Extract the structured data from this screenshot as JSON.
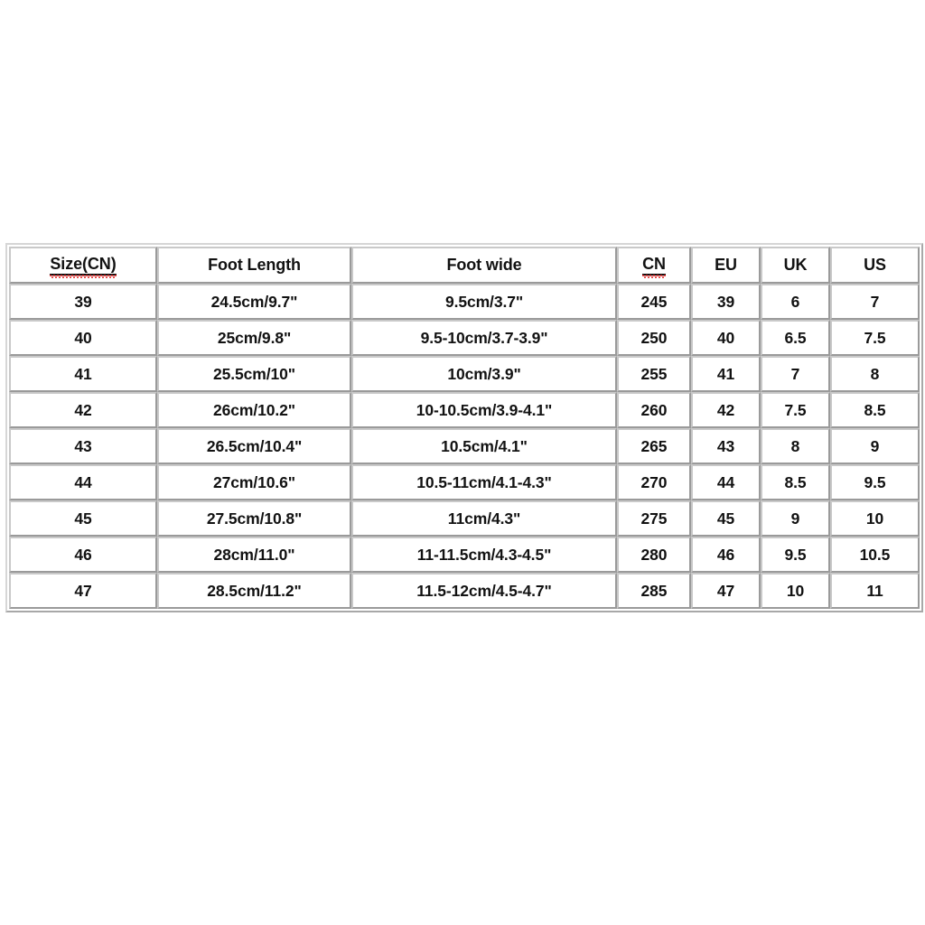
{
  "page": {
    "background_color": "#ffffff",
    "text_color": "#121212",
    "border_color": "#9a9a9a",
    "spellcheck_color": "#e01b1b"
  },
  "table": {
    "name": "shoe-size-conversion-chart",
    "headers": [
      {
        "label": "Size(CN)",
        "underlined": true,
        "spellcheck": true
      },
      {
        "label": "Foot Length",
        "underlined": false,
        "spellcheck": false
      },
      {
        "label": "Foot wide",
        "underlined": false,
        "spellcheck": false
      },
      {
        "label": "CN",
        "underlined": true,
        "spellcheck": true
      },
      {
        "label": "EU",
        "underlined": false,
        "spellcheck": false
      },
      {
        "label": "UK",
        "underlined": false,
        "spellcheck": false
      },
      {
        "label": "US",
        "underlined": false,
        "spellcheck": false
      }
    ],
    "rows": [
      {
        "size_cn": "39",
        "foot_length": "24.5cm/9.7\"",
        "foot_wide": "9.5cm/3.7\"",
        "cn": "245",
        "eu": "39",
        "uk": "6",
        "us": "7"
      },
      {
        "size_cn": "40",
        "foot_length": "25cm/9.8\"",
        "foot_wide": "9.5-10cm/3.7-3.9\"",
        "cn": "250",
        "eu": "40",
        "uk": "6.5",
        "us": "7.5"
      },
      {
        "size_cn": "41",
        "foot_length": "25.5cm/10\"",
        "foot_wide": "10cm/3.9\"",
        "cn": "255",
        "eu": "41",
        "uk": "7",
        "us": "8"
      },
      {
        "size_cn": "42",
        "foot_length": "26cm/10.2\"",
        "foot_wide": "10-10.5cm/3.9-4.1\"",
        "cn": "260",
        "eu": "42",
        "uk": "7.5",
        "us": "8.5"
      },
      {
        "size_cn": "43",
        "foot_length": "26.5cm/10.4\"",
        "foot_wide": "10.5cm/4.1\"",
        "cn": "265",
        "eu": "43",
        "uk": "8",
        "us": "9"
      },
      {
        "size_cn": "44",
        "foot_length": "27cm/10.6\"",
        "foot_wide": "10.5-11cm/4.1-4.3\"",
        "cn": "270",
        "eu": "44",
        "uk": "8.5",
        "us": "9.5"
      },
      {
        "size_cn": "45",
        "foot_length": "27.5cm/10.8\"",
        "foot_wide": "11cm/4.3\"",
        "cn": "275",
        "eu": "45",
        "uk": "9",
        "us": "10"
      },
      {
        "size_cn": "46",
        "foot_length": "28cm/11.0\"",
        "foot_wide": "11-11.5cm/4.3-4.5\"",
        "cn": "280",
        "eu": "46",
        "uk": "9.5",
        "us": "10.5"
      },
      {
        "size_cn": "47",
        "foot_length": "28.5cm/11.2\"",
        "foot_wide": "11.5-12cm/4.5-4.7\"",
        "cn": "285",
        "eu": "47",
        "uk": "10",
        "us": "11"
      }
    ]
  }
}
